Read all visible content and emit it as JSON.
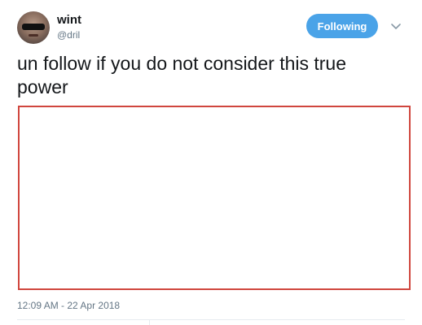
{
  "user": {
    "display_name": "wint",
    "handle": "@dril"
  },
  "follow_button": {
    "label": "Following"
  },
  "tweet": {
    "text": "un follow if you do not consider this true power",
    "timestamp": "12:09 AM - 22 Apr 2018"
  },
  "icons": {
    "avatar": "profile-avatar",
    "caret": "chevron-down-icon"
  },
  "colors": {
    "accent": "#4aa3e8",
    "media_border": "#d0463e"
  }
}
